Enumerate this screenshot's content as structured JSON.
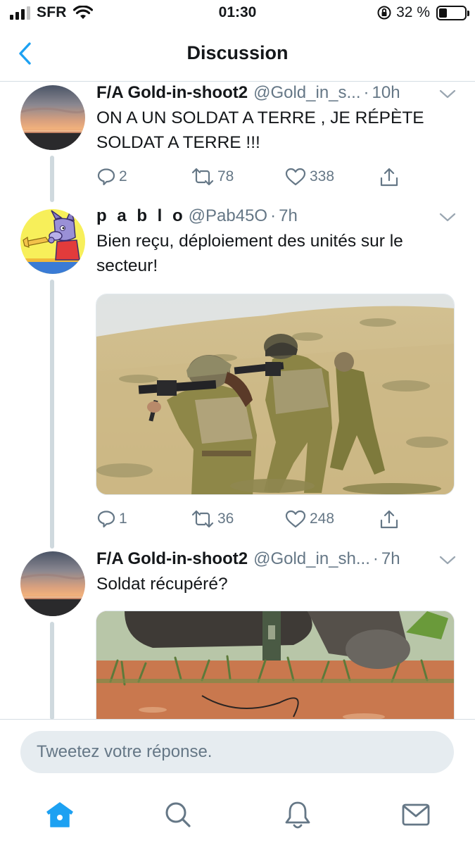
{
  "status_bar": {
    "carrier": "SFR",
    "time": "01:30",
    "battery_percent": "32 %",
    "battery_level": 0.32
  },
  "header": {
    "title": "Discussion",
    "back_icon": "chevron-left-icon"
  },
  "colors": {
    "accent": "#1da1f2",
    "text": "#14171a",
    "secondary": "#657786",
    "thread_line": "#cfd9de",
    "input_bg": "#e6ecf0"
  },
  "tweets": [
    {
      "name": "F/A Gold-in-shoot2",
      "handle": "@Gold_in_s...",
      "dot": "·",
      "time": "10h",
      "text": "ON A UN SOLDAT A TERRE , JE RÉPÈTE SOLDAT A TERRE !!!",
      "replies": "2",
      "retweets": "78",
      "likes": "338"
    },
    {
      "name": "p a b l o",
      "handle": "@Pab45O",
      "dot": "·",
      "time": "7h",
      "text": "Bien reçu, déploiement des unités sur le secteur!",
      "replies": "1",
      "retweets": "36",
      "likes": "248"
    },
    {
      "name": "F/A Gold-in-shoot2",
      "handle": "@Gold_in_sh...",
      "dot": "·",
      "time": "7h",
      "text": "Soldat récupéré?"
    }
  ],
  "reply": {
    "placeholder": "Tweetez votre réponse."
  },
  "tabs": [
    {
      "icon": "home-icon",
      "active": true
    },
    {
      "icon": "search-icon",
      "active": false
    },
    {
      "icon": "bell-icon",
      "active": false
    },
    {
      "icon": "mail-icon",
      "active": false
    }
  ]
}
